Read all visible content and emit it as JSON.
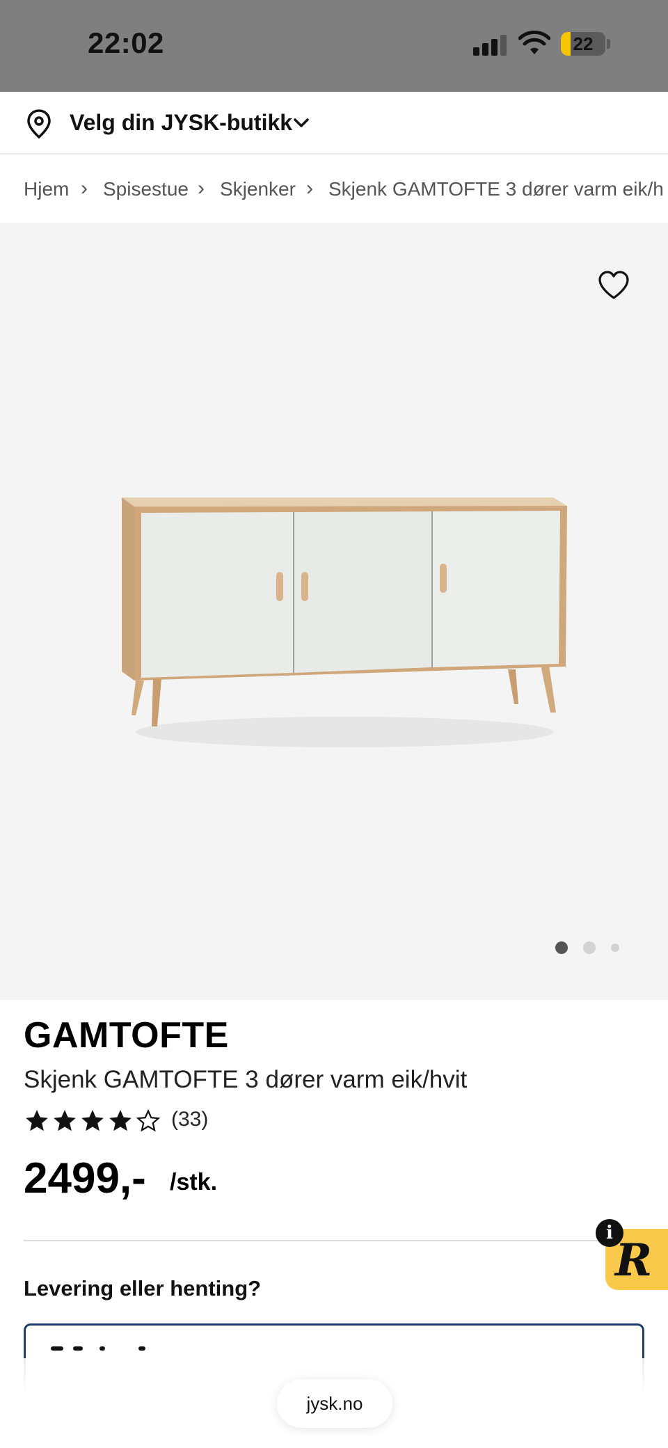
{
  "status_bar": {
    "time": "22:02",
    "battery_level": "22",
    "icons": [
      "cellular-signal-icon",
      "wifi-icon",
      "battery-icon"
    ]
  },
  "store_selector": {
    "label": "Velg din JYSK-butikk",
    "icons": [
      "location-pin-icon",
      "chevron-down-icon"
    ]
  },
  "breadcrumb": {
    "items": [
      "Hjem",
      "Spisestue",
      "Skjenker",
      "Skjenk GAMTOFTE 3 dører varm eik/h"
    ],
    "separator": "›"
  },
  "gallery": {
    "image": "white-sideboard-three-doors-oak-frame",
    "slide_count": 3,
    "active_slide": 1,
    "favorite_icon": "heart-outline-icon"
  },
  "product": {
    "brand": "GAMTOFTE",
    "name": "Skjenk GAMTOFTE 3 dører varm eik/hvit",
    "rating": 4,
    "rating_max": 5,
    "review_count": "(33)",
    "price": "2499,-",
    "price_unit": "/stk."
  },
  "delivery": {
    "heading": "Levering eller henting?"
  },
  "widget": {
    "letter": "R",
    "info": "i"
  },
  "browser": {
    "url": "jysk.no"
  },
  "colors": {
    "status_bar_bg": "#7f7f7f",
    "battery_fill": "#f6c400",
    "gallery_bg": "#f4f4f4",
    "delivery_box_border": "#1e3a6e",
    "widget_bg": "#f9c94b"
  }
}
